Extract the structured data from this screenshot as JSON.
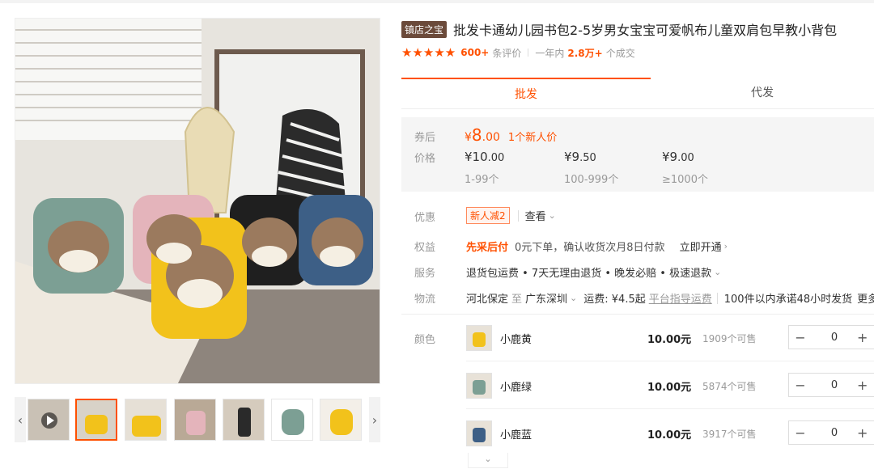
{
  "product": {
    "shop_badge": "镇店之宝",
    "title": "批发卡通幼儿园书包2-5岁男女宝宝可爱帆布儿童双肩包早教小背包",
    "stars": "★★★★★",
    "reviews_count": "600+",
    "reviews_label": "条评价",
    "sales_period": "一年内",
    "sales_count": "2.8万+",
    "sales_label": "个成交"
  },
  "gallery": {
    "prev_glyph": "‹",
    "next_glyph": "›",
    "thumbnails": [
      "视频缩略图",
      "缩略图2",
      "缩略图3",
      "缩略图4",
      "缩略图5",
      "缩略图6",
      "缩略图7"
    ]
  },
  "tabs": {
    "wholesale": "批发",
    "dropship": "代发"
  },
  "pricing": {
    "after_coupon_label": "券后",
    "price_label": "价格",
    "currency": "¥",
    "coupon_price_int": "8",
    "coupon_price_dec": ".00",
    "newbie_text": "1个新人价",
    "tiers": [
      {
        "int": "10",
        "dec": ".00",
        "range": "1-99个"
      },
      {
        "int": "9",
        "dec": ".50",
        "range": "100-999个"
      },
      {
        "int": "9",
        "dec": ".00",
        "range": "≥1000个"
      }
    ]
  },
  "info": {
    "discount_label": "优惠",
    "coupon_tag": "新人减2",
    "view_more": "查看",
    "rights_label": "权益",
    "rights_title": "先采后付",
    "rights_desc": "0元下单，确认收货次月8日付款",
    "rights_action": "立即开通",
    "service_label": "服务",
    "service_text": "退货包运费 • 7天无理由退货 • 晚发必赔 • 极速退款",
    "logistics_label": "物流",
    "from": "河北保定",
    "to_word": "至",
    "to": "广东深圳",
    "shipping": "运费: ¥4.5起",
    "shipping_ref": "平台指导运费",
    "promise": "100件以内承诺48小时发货",
    "more": "更多"
  },
  "skus": {
    "color_label": "颜色",
    "items": [
      {
        "name": "小鹿黄",
        "price": "10.00元",
        "stock": "1909个可售",
        "qty": "0"
      },
      {
        "name": "小鹿绿",
        "price": "10.00元",
        "stock": "5874个可售",
        "qty": "0"
      },
      {
        "name": "小鹿蓝",
        "price": "10.00元",
        "stock": "3917个可售",
        "qty": "0"
      }
    ],
    "minus": "−",
    "plus": "+",
    "expand": "⌄"
  },
  "colors": {
    "accent": "#ff5000",
    "badge": "#6b4a3a"
  }
}
